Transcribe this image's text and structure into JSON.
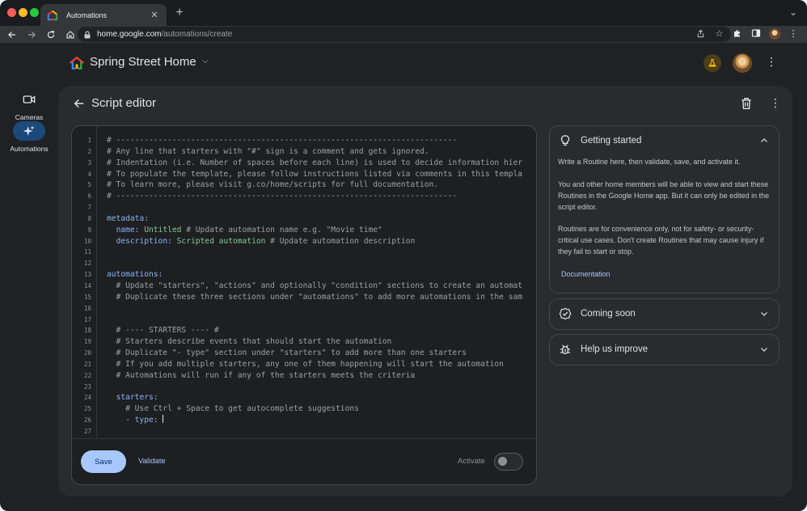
{
  "browser": {
    "tab_title": "Automations",
    "url_host": "home.google.com",
    "url_path": "/automations/create"
  },
  "app": {
    "home_name": "Spring Street Home"
  },
  "rail": {
    "items": [
      {
        "label": "Cameras",
        "icon": "video-camera-icon",
        "active": false
      },
      {
        "label": "Automations",
        "icon": "sparkle-icon",
        "active": true
      }
    ]
  },
  "page": {
    "title": "Script editor"
  },
  "editor": {
    "lines": [
      [
        {
          "t": "c",
          "v": "# -------------------------------------------------------------------------"
        }
      ],
      [
        {
          "t": "c",
          "v": "# Any line that starters with \"#\" sign is a comment and gets ignored."
        }
      ],
      [
        {
          "t": "c",
          "v": "# Indentation (i.e. Number of spaces before each line) is used to decide information hier"
        }
      ],
      [
        {
          "t": "c",
          "v": "# To populate the template, please follow instructions listed via comments in this templa"
        }
      ],
      [
        {
          "t": "c",
          "v": "# To learn more, please visit g.co/home/scripts for full documentation."
        }
      ],
      [
        {
          "t": "c",
          "v": "# -------------------------------------------------------------------------"
        }
      ],
      [],
      [
        {
          "t": "k",
          "v": "metadata:"
        }
      ],
      [
        {
          "t": "p",
          "v": "  "
        },
        {
          "t": "k",
          "v": "name: "
        },
        {
          "t": "v",
          "v": "Untitled"
        },
        {
          "t": "c",
          "v": " # Update automation name e.g. \"Movie time\""
        }
      ],
      [
        {
          "t": "p",
          "v": "  "
        },
        {
          "t": "k",
          "v": "description: "
        },
        {
          "t": "v",
          "v": "Scripted automation"
        },
        {
          "t": "c",
          "v": " # Update automation description"
        }
      ],
      [],
      [],
      [
        {
          "t": "k",
          "v": "automations:"
        }
      ],
      [
        {
          "t": "c",
          "v": "  # Update \"starters\", \"actions\" and optionally \"condition\" sections to create an automat"
        }
      ],
      [
        {
          "t": "c",
          "v": "  # Duplicate these three sections under \"automations\" to add more automations in the sam"
        }
      ],
      [],
      [],
      [
        {
          "t": "c",
          "v": "  # ---- STARTERS ---- #"
        }
      ],
      [
        {
          "t": "c",
          "v": "  # Starters describe events that should start the automation"
        }
      ],
      [
        {
          "t": "c",
          "v": "  # Duplicate \"- type\" section under \"starters\" to add more than one starters"
        }
      ],
      [
        {
          "t": "c",
          "v": "  # If you add multiple starters, any one of them happening will start the automation"
        }
      ],
      [
        {
          "t": "c",
          "v": "  # Automations will run if any of the starters meets the criteria"
        }
      ],
      [],
      [
        {
          "t": "p",
          "v": "  "
        },
        {
          "t": "k",
          "v": "starters:"
        }
      ],
      [
        {
          "t": "c",
          "v": "    # Use Ctrl + Space to get autocomplete suggestions"
        }
      ],
      [
        {
          "t": "p",
          "v": "    "
        },
        {
          "t": "k",
          "v": "- type: "
        },
        {
          "t": "cursor",
          "v": ""
        }
      ],
      []
    ],
    "save_label": "Save",
    "validate_label": "Validate",
    "activate_label": "Activate",
    "activate_on": false
  },
  "panels": {
    "getting_started": {
      "title": "Getting started",
      "p1": "Write a Routine here, then validate, save, and activate it.",
      "p2": "You and other home members will be able to view and start these Routines in the Google Home app. But it can only be edited in the script editor.",
      "p3": "Routines are for convenience only, not for safety- or security-critical use cases. Don't create Routines that may cause injury if they fail to start or stop.",
      "link": "Documentation"
    },
    "coming_soon": {
      "title": "Coming soon"
    },
    "help_improve": {
      "title": "Help us improve"
    }
  },
  "colors": {
    "accent": "#a8c7fa",
    "background": "#202124",
    "card": "#2a2b2e",
    "editor": "#1e1f21"
  }
}
